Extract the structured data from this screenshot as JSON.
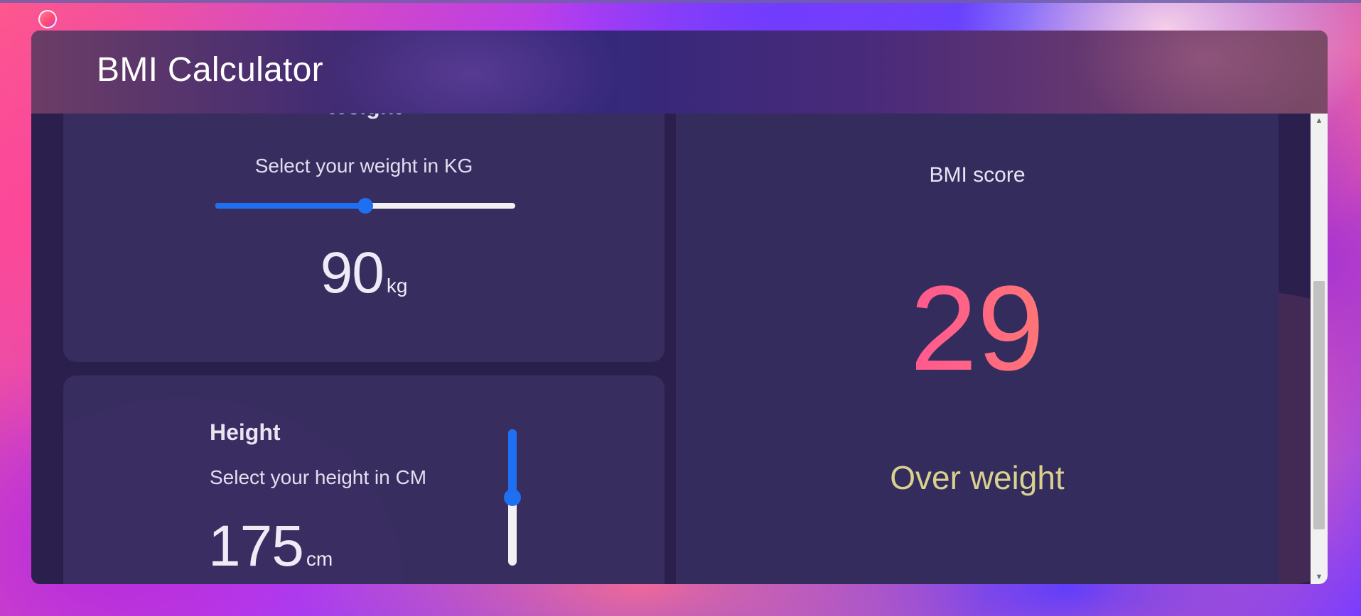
{
  "header": {
    "title": "BMI Calculator"
  },
  "weight": {
    "title": "Weight",
    "helper": "Select your weight in KG",
    "value": "90",
    "unit": "kg",
    "slider_fraction": 0.5
  },
  "height": {
    "title": "Height",
    "helper": "Select your height in CM",
    "value": "175",
    "unit": "cm",
    "slider_fraction": 0.5
  },
  "result": {
    "label": "BMI score",
    "score": "29",
    "category": "Over weight"
  },
  "colors": {
    "accent": "#1f6ff2",
    "category_text": "#d9d18e",
    "score_gradient_start": "#ff3aa0",
    "score_gradient_end": "#ffa04e"
  },
  "icons": {
    "scroll_up": "▲",
    "scroll_down": "▼"
  }
}
